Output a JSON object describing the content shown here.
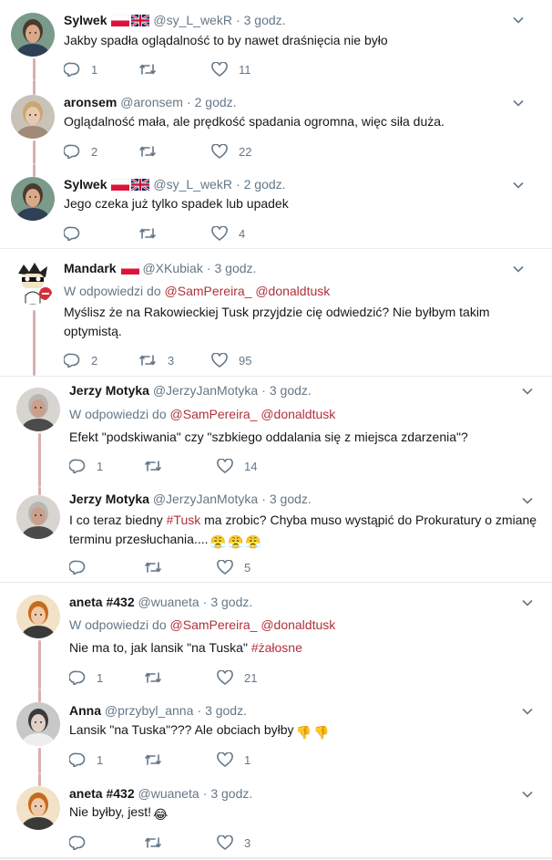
{
  "tweets": [
    {
      "name": "Sylwek",
      "handle": "@sy_L_wekR",
      "time": "3 godz.",
      "flags": [
        "pl",
        "uk"
      ],
      "text": "Jakby spadła oglądalność to by nawet draśnięcia nie było",
      "reply": "1",
      "retweet": "",
      "like": "11"
    },
    {
      "name": "aronsem",
      "handle": "@aronsem",
      "time": "2 godz.",
      "flags": [],
      "text": "Oglądalność mała, ale prędkość spadania ogromna, więc siła duża.",
      "reply": "2",
      "retweet": "",
      "like": "22"
    },
    {
      "name": "Sylwek",
      "handle": "@sy_L_wekR",
      "time": "2 godz.",
      "flags": [
        "pl",
        "uk"
      ],
      "text": "Jego czeka już tylko spadek lub upadek",
      "reply": "",
      "retweet": "",
      "like": "4"
    },
    {
      "name": "Mandark",
      "handle": "@XKubiak",
      "time": "3 godz.",
      "flags": [
        "pl"
      ],
      "reply_to_label": "W odpowiedzi do",
      "reply_to": [
        "@SamPereira_",
        "@donaldtusk"
      ],
      "text": "Myślisz że na Rakowieckiej Tusk przyjdzie cię odwiedzić? Nie byłbym takim optymistą.",
      "reply": "2",
      "retweet": "3",
      "like": "95"
    },
    {
      "name": "Jerzy Motyka",
      "handle": "@JerzyJanMotyka",
      "time": "3 godz.",
      "flags": [],
      "reply_to_label": "W odpowiedzi do",
      "reply_to": [
        "@SamPereira_",
        "@donaldtusk"
      ],
      "text": "Efekt \"podskiwania\" czy \"szbkiego oddalania się z miejsca zdarzenia\"?",
      "reply": "1",
      "retweet": "",
      "like": "14"
    },
    {
      "name": "Jerzy Motyka",
      "handle": "@JerzyJanMotyka",
      "time": "3 godz.",
      "flags": [],
      "text_before": "I co teraz biedny ",
      "hashtag": "#Tusk",
      "text_after": " ma zrobic? Chyba muso wystąpić do Prokuratury o zmianę terminu przesłuchania....",
      "emoji": [
        "😤",
        "😤",
        "😤"
      ],
      "reply": "",
      "retweet": "",
      "like": "5"
    },
    {
      "name": "aneta #432",
      "handle": "@wuaneta",
      "time": "3 godz.",
      "flags": [],
      "reply_to_label": "W odpowiedzi do",
      "reply_to": [
        "@SamPereira_",
        "@donaldtusk"
      ],
      "text_before": "Nie ma to, jak lansik \"na Tuska\" ",
      "hashtag": "#żałosne",
      "reply": "1",
      "retweet": "",
      "like": "21"
    },
    {
      "name": "Anna",
      "handle": "@przybyl_anna",
      "time": "3 godz.",
      "flags": [],
      "text": "Lansik \"na Tuska\"??? Ale obciach byłby",
      "emoji": [
        "👎",
        "👎"
      ],
      "reply": "1",
      "retweet": "",
      "like": "1"
    },
    {
      "name": "aneta #432",
      "handle": "@wuaneta",
      "time": "3 godz.",
      "flags": [],
      "text": "Nie byłby, jest!",
      "emoji": [
        "😂"
      ],
      "reply": "",
      "retweet": "",
      "like": "3"
    }
  ],
  "separator": "·",
  "colors": {
    "accent": "#b0303a",
    "thread": "#d8aeb3",
    "muted": "#657786"
  }
}
